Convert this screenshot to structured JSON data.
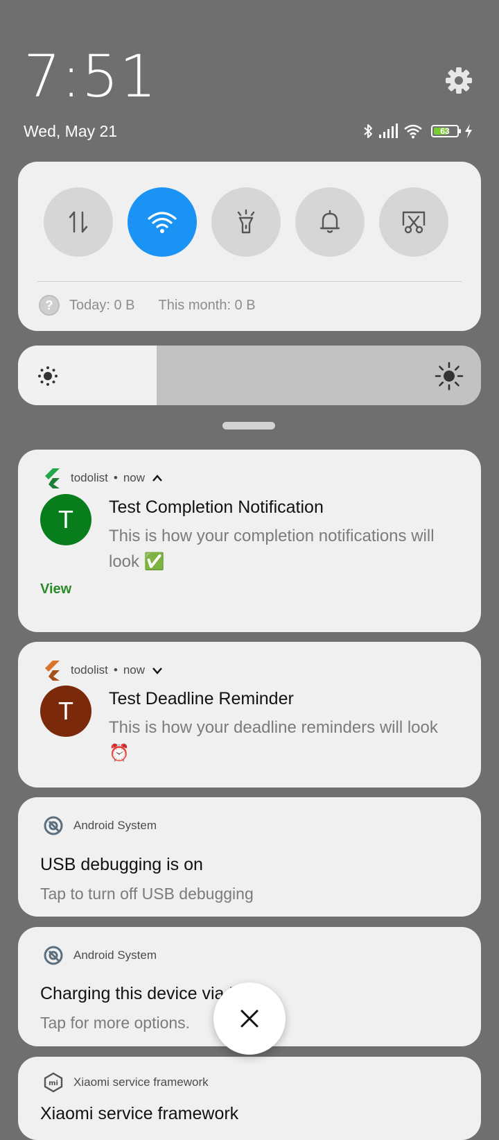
{
  "lockscreen": {
    "time": "7:51",
    "date": "Wed, May 21",
    "battery_level": "63",
    "battery_color": "#7ccb38",
    "status_icons": [
      "bluetooth-icon",
      "cellular-signal-icon",
      "wifi-icon",
      "battery-icon",
      "charging-bolt-icon"
    ]
  },
  "quick_settings": {
    "tiles": [
      {
        "name": "mobile-data",
        "icon": "data-arrows-icon",
        "active": false
      },
      {
        "name": "wifi",
        "icon": "wifi-icon",
        "active": true
      },
      {
        "name": "flashlight",
        "icon": "flashlight-icon",
        "active": false
      },
      {
        "name": "sound",
        "icon": "bell-icon",
        "active": false
      },
      {
        "name": "screenshot",
        "icon": "scissors-screenshot-icon",
        "active": false
      }
    ],
    "accent": "#1a93f5",
    "data_usage": {
      "today": "Today: 0 B",
      "month": "This month: 0 B"
    }
  },
  "brightness": {
    "level_percent": 30,
    "low_icon": "brightness-low-icon",
    "high_icon": "brightness-high-icon"
  },
  "notifications": [
    {
      "app": "todolist",
      "time": "now",
      "expanded": true,
      "avatar_letter": "T",
      "avatar_color": "#087d1b",
      "title": "Test Completion Notification",
      "text": "This is how your completion notifications will look ✅",
      "action": "View"
    },
    {
      "app": "todolist",
      "time": "now",
      "expanded": false,
      "avatar_letter": "T",
      "avatar_color": "#7a2a0a",
      "title": "Test Deadline Reminder",
      "text": "This is how your deadline reminders will look ⏰"
    },
    {
      "app": "Android System",
      "title": "USB debugging is on",
      "text": "Tap to turn off USB debugging"
    },
    {
      "app": "Android System",
      "title": "Charging this device via USB",
      "text": "Tap for more options."
    },
    {
      "app": "Xiaomi service framework",
      "title": "Xiaomi service framework"
    }
  ],
  "dismiss_all_icon": "close-icon"
}
